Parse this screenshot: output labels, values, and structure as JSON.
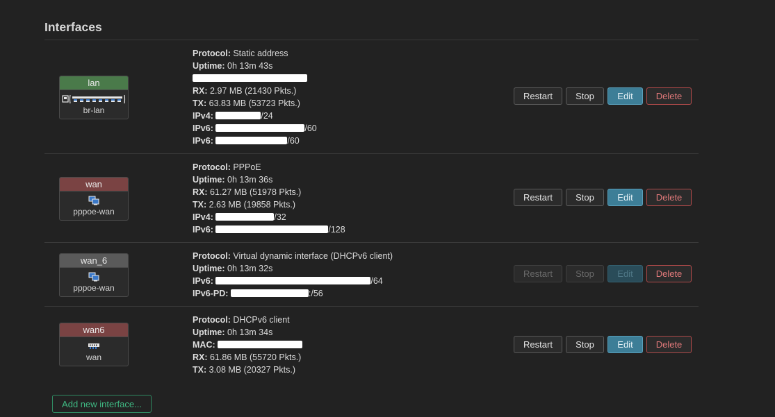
{
  "section": {
    "title": "Interfaces"
  },
  "interfaces": [
    {
      "name": "lan",
      "device": "br-lan",
      "head_color": "#4a7a4a",
      "icon": "bridge-network-icon",
      "lines": [
        {
          "label": "Protocol:",
          "value": "Static address"
        },
        {
          "label": "Uptime:",
          "value": "0h 13m 43s"
        },
        {
          "label": "",
          "value": ""
        },
        {
          "label": "RX:",
          "value": "2.97 MB (21430 Pkts.)"
        },
        {
          "label": "TX:",
          "value": "63.83 MB (53723 Pkts.)"
        },
        {
          "label": "IPv4:",
          "value": "/24"
        },
        {
          "label": "IPv6:",
          "value": "/60"
        },
        {
          "label": "IPv6:",
          "value": "/60"
        }
      ],
      "buttons": {
        "restart": "Restart",
        "stop": "Stop",
        "edit": "Edit",
        "delete": "Delete"
      }
    },
    {
      "name": "wan",
      "device": "pppoe-wan",
      "head_color": "#7a4343",
      "icon": "tunnel-interface-icon",
      "lines": [
        {
          "label": "Protocol:",
          "value": "PPPoE"
        },
        {
          "label": "Uptime:",
          "value": "0h 13m 36s"
        },
        {
          "label": "RX:",
          "value": "61.27 MB (51978 Pkts.)"
        },
        {
          "label": "TX:",
          "value": "2.63 MB (19858 Pkts.)"
        },
        {
          "label": "IPv4:",
          "value": "/32"
        },
        {
          "label": "IPv6:",
          "value": "/128"
        }
      ],
      "buttons": {
        "restart": "Restart",
        "stop": "Stop",
        "edit": "Edit",
        "delete": "Delete"
      }
    },
    {
      "name": "wan_6",
      "device": "pppoe-wan",
      "head_color": "#5a5a5a",
      "icon": "tunnel-interface-icon",
      "lines": [
        {
          "label": "Protocol:",
          "value": "Virtual dynamic interface (DHCPv6 client)"
        },
        {
          "label": "Uptime:",
          "value": "0h 13m 32s"
        },
        {
          "label": "IPv6:",
          "value": "/64"
        },
        {
          "label": "IPv6-PD:",
          "value": ":/56"
        }
      ],
      "buttons": {
        "restart": "Restart",
        "stop": "Stop",
        "edit": "Edit",
        "delete": "Delete"
      }
    },
    {
      "name": "wan6",
      "device": "wan",
      "head_color": "#7a4343",
      "icon": "ethernet-port-icon",
      "lines": [
        {
          "label": "Protocol:",
          "value": "DHCPv6 client"
        },
        {
          "label": "Uptime:",
          "value": "0h 13m 34s"
        },
        {
          "label": "MAC:",
          "value": ""
        },
        {
          "label": "RX:",
          "value": "61.86 MB (55720 Pkts.)"
        },
        {
          "label": "TX:",
          "value": "3.08 MB (20327 Pkts.)"
        }
      ],
      "buttons": {
        "restart": "Restart",
        "stop": "Stop",
        "edit": "Edit",
        "delete": "Delete"
      }
    }
  ],
  "add_interface_label": "Add new interface..."
}
